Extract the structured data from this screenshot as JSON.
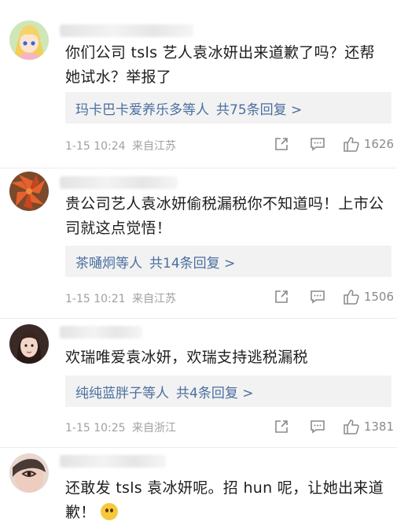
{
  "comments": [
    {
      "text": "你们公司 tsls 艺人袁冰妍出来道歉了吗？还帮她试水？举报了",
      "reply_users": "玛卡巴卡爱养乐多",
      "reply_suffix": "等人",
      "reply_count": "共75条回复 >",
      "date": "1-15 10:24",
      "location": "来自江苏",
      "likes": "1626"
    },
    {
      "text": "贵公司艺人袁冰妍偷税漏税你不知道吗！上市公司就这点觉悟！",
      "reply_users": "茶嗵炯",
      "reply_suffix": "等人",
      "reply_count": "共14条回复 >",
      "date": "1-15 10:21",
      "location": "来自江苏",
      "likes": "1506"
    },
    {
      "text": "欢瑞唯爱袁冰妍，欢瑞支持逃税漏税",
      "reply_users": "纯纯蓝胖子",
      "reply_suffix": "等人",
      "reply_count": "共4条回复 >",
      "date": "1-15 10:25",
      "location": "来自浙江",
      "likes": "1381"
    },
    {
      "text": "还敢发 tsls 袁冰妍呢。招 hun 呢，让她出来道歉！"
    }
  ]
}
